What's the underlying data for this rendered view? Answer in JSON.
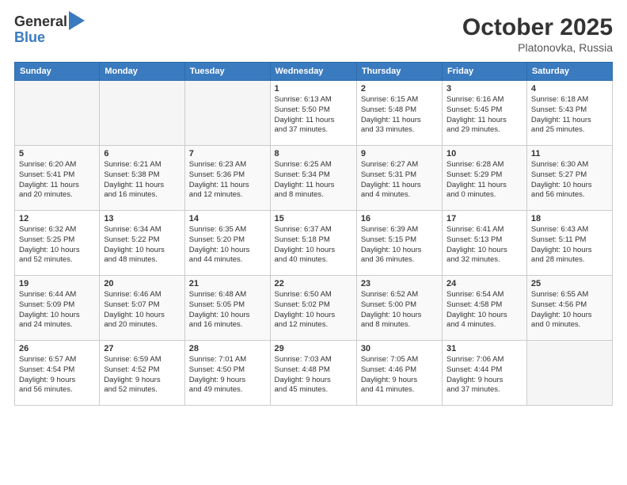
{
  "header": {
    "logo_general": "General",
    "logo_blue": "Blue",
    "month": "October 2025",
    "location": "Platonovka, Russia"
  },
  "days_of_week": [
    "Sunday",
    "Monday",
    "Tuesday",
    "Wednesday",
    "Thursday",
    "Friday",
    "Saturday"
  ],
  "weeks": [
    [
      {
        "num": "",
        "info": ""
      },
      {
        "num": "",
        "info": ""
      },
      {
        "num": "",
        "info": ""
      },
      {
        "num": "1",
        "info": "Sunrise: 6:13 AM\nSunset: 5:50 PM\nDaylight: 11 hours\nand 37 minutes."
      },
      {
        "num": "2",
        "info": "Sunrise: 6:15 AM\nSunset: 5:48 PM\nDaylight: 11 hours\nand 33 minutes."
      },
      {
        "num": "3",
        "info": "Sunrise: 6:16 AM\nSunset: 5:45 PM\nDaylight: 11 hours\nand 29 minutes."
      },
      {
        "num": "4",
        "info": "Sunrise: 6:18 AM\nSunset: 5:43 PM\nDaylight: 11 hours\nand 25 minutes."
      }
    ],
    [
      {
        "num": "5",
        "info": "Sunrise: 6:20 AM\nSunset: 5:41 PM\nDaylight: 11 hours\nand 20 minutes."
      },
      {
        "num": "6",
        "info": "Sunrise: 6:21 AM\nSunset: 5:38 PM\nDaylight: 11 hours\nand 16 minutes."
      },
      {
        "num": "7",
        "info": "Sunrise: 6:23 AM\nSunset: 5:36 PM\nDaylight: 11 hours\nand 12 minutes."
      },
      {
        "num": "8",
        "info": "Sunrise: 6:25 AM\nSunset: 5:34 PM\nDaylight: 11 hours\nand 8 minutes."
      },
      {
        "num": "9",
        "info": "Sunrise: 6:27 AM\nSunset: 5:31 PM\nDaylight: 11 hours\nand 4 minutes."
      },
      {
        "num": "10",
        "info": "Sunrise: 6:28 AM\nSunset: 5:29 PM\nDaylight: 11 hours\nand 0 minutes."
      },
      {
        "num": "11",
        "info": "Sunrise: 6:30 AM\nSunset: 5:27 PM\nDaylight: 10 hours\nand 56 minutes."
      }
    ],
    [
      {
        "num": "12",
        "info": "Sunrise: 6:32 AM\nSunset: 5:25 PM\nDaylight: 10 hours\nand 52 minutes."
      },
      {
        "num": "13",
        "info": "Sunrise: 6:34 AM\nSunset: 5:22 PM\nDaylight: 10 hours\nand 48 minutes."
      },
      {
        "num": "14",
        "info": "Sunrise: 6:35 AM\nSunset: 5:20 PM\nDaylight: 10 hours\nand 44 minutes."
      },
      {
        "num": "15",
        "info": "Sunrise: 6:37 AM\nSunset: 5:18 PM\nDaylight: 10 hours\nand 40 minutes."
      },
      {
        "num": "16",
        "info": "Sunrise: 6:39 AM\nSunset: 5:15 PM\nDaylight: 10 hours\nand 36 minutes."
      },
      {
        "num": "17",
        "info": "Sunrise: 6:41 AM\nSunset: 5:13 PM\nDaylight: 10 hours\nand 32 minutes."
      },
      {
        "num": "18",
        "info": "Sunrise: 6:43 AM\nSunset: 5:11 PM\nDaylight: 10 hours\nand 28 minutes."
      }
    ],
    [
      {
        "num": "19",
        "info": "Sunrise: 6:44 AM\nSunset: 5:09 PM\nDaylight: 10 hours\nand 24 minutes."
      },
      {
        "num": "20",
        "info": "Sunrise: 6:46 AM\nSunset: 5:07 PM\nDaylight: 10 hours\nand 20 minutes."
      },
      {
        "num": "21",
        "info": "Sunrise: 6:48 AM\nSunset: 5:05 PM\nDaylight: 10 hours\nand 16 minutes."
      },
      {
        "num": "22",
        "info": "Sunrise: 6:50 AM\nSunset: 5:02 PM\nDaylight: 10 hours\nand 12 minutes."
      },
      {
        "num": "23",
        "info": "Sunrise: 6:52 AM\nSunset: 5:00 PM\nDaylight: 10 hours\nand 8 minutes."
      },
      {
        "num": "24",
        "info": "Sunrise: 6:54 AM\nSunset: 4:58 PM\nDaylight: 10 hours\nand 4 minutes."
      },
      {
        "num": "25",
        "info": "Sunrise: 6:55 AM\nSunset: 4:56 PM\nDaylight: 10 hours\nand 0 minutes."
      }
    ],
    [
      {
        "num": "26",
        "info": "Sunrise: 6:57 AM\nSunset: 4:54 PM\nDaylight: 9 hours\nand 56 minutes."
      },
      {
        "num": "27",
        "info": "Sunrise: 6:59 AM\nSunset: 4:52 PM\nDaylight: 9 hours\nand 52 minutes."
      },
      {
        "num": "28",
        "info": "Sunrise: 7:01 AM\nSunset: 4:50 PM\nDaylight: 9 hours\nand 49 minutes."
      },
      {
        "num": "29",
        "info": "Sunrise: 7:03 AM\nSunset: 4:48 PM\nDaylight: 9 hours\nand 45 minutes."
      },
      {
        "num": "30",
        "info": "Sunrise: 7:05 AM\nSunset: 4:46 PM\nDaylight: 9 hours\nand 41 minutes."
      },
      {
        "num": "31",
        "info": "Sunrise: 7:06 AM\nSunset: 4:44 PM\nDaylight: 9 hours\nand 37 minutes."
      },
      {
        "num": "",
        "info": ""
      }
    ]
  ]
}
